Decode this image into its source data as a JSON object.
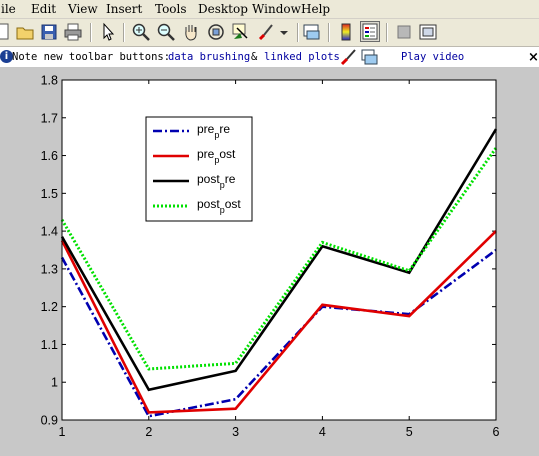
{
  "menubar": {
    "items": [
      "ile",
      "Edit",
      "View",
      "Insert",
      "Tools",
      "Desktop",
      "Window",
      "Help"
    ]
  },
  "toolbar": {
    "buttons": [
      "new-file-icon",
      "open-folder-icon",
      "save-icon",
      "print-icon",
      "pointer-icon",
      "zoom-in-icon",
      "zoom-out-icon",
      "pan-hand-icon",
      "rotate-3d-icon",
      "data-cursor-icon",
      "brush-icon",
      "link-plot-icon",
      "colorbar-icon",
      "legend-icon",
      "hide-plot-tools-icon",
      "show-plot-tools-icon"
    ]
  },
  "infobar": {
    "note": "Note new toolbar buttons:",
    "link1": "data brushing",
    "amp": "&",
    "link2": "linked plots",
    "video": "Play video"
  },
  "chart_data": {
    "type": "line",
    "x": [
      1,
      2,
      3,
      4,
      5,
      6
    ],
    "xlim": [
      1,
      6
    ],
    "ylim": [
      0.9,
      1.8
    ],
    "xticks": [
      "1",
      "2",
      "3",
      "4",
      "5",
      "6"
    ],
    "yticks": [
      "0.9",
      "1",
      "1.1",
      "1.2",
      "1.3",
      "1.4",
      "1.5",
      "1.6",
      "1.7",
      "1.8"
    ],
    "legend_position": "upper-left",
    "series": [
      {
        "name": "pre_pre",
        "legend_main": "pre",
        "legend_sub": "p",
        "legend_tail": "re",
        "color": "#0000b0",
        "style": "dashdot",
        "values": [
          1.33,
          0.91,
          0.955,
          1.2,
          1.18,
          1.35
        ]
      },
      {
        "name": "pre_post",
        "legend_main": "pre",
        "legend_sub": "p",
        "legend_tail": "ost",
        "color": "#e00000",
        "style": "solid",
        "values": [
          1.375,
          0.92,
          0.93,
          1.205,
          1.175,
          1.4
        ]
      },
      {
        "name": "post_pre",
        "legend_main": "post",
        "legend_sub": "p",
        "legend_tail": "re",
        "color": "#000000",
        "style": "solid",
        "values": [
          1.385,
          0.98,
          1.03,
          1.36,
          1.29,
          1.67
        ]
      },
      {
        "name": "post_post",
        "legend_main": "post",
        "legend_sub": "p",
        "legend_tail": "ost",
        "color": "#00e000",
        "style": "dotted",
        "values": [
          1.43,
          1.035,
          1.05,
          1.37,
          1.295,
          1.62
        ]
      }
    ]
  }
}
